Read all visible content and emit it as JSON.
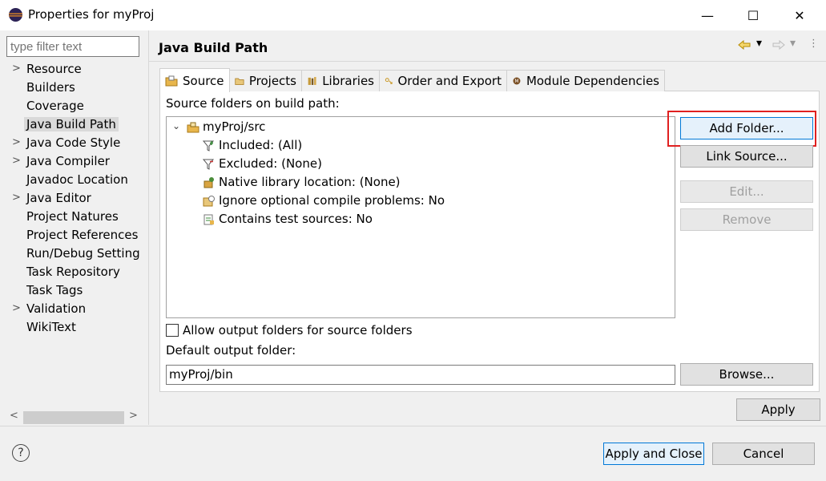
{
  "window": {
    "title": "Properties for myProj",
    "minimize_glyph": "—",
    "maximize_glyph": "☐",
    "close_glyph": "✕"
  },
  "filter": {
    "placeholder": "type filter text"
  },
  "left_tree": [
    {
      "label": "Resource",
      "expandable": true
    },
    {
      "label": "Builders",
      "expandable": false
    },
    {
      "label": "Coverage",
      "expandable": false
    },
    {
      "label": "Java Build Path",
      "expandable": false,
      "selected": true
    },
    {
      "label": "Java Code Style",
      "expandable": true
    },
    {
      "label": "Java Compiler",
      "expandable": true
    },
    {
      "label": "Javadoc Location",
      "expandable": false
    },
    {
      "label": "Java Editor",
      "expandable": true
    },
    {
      "label": "Project Natures",
      "expandable": false
    },
    {
      "label": "Project References",
      "expandable": false
    },
    {
      "label": "Run/Debug Setting",
      "expandable": false
    },
    {
      "label": "Task Repository",
      "expandable": false
    },
    {
      "label": "Task Tags",
      "expandable": false
    },
    {
      "label": "Validation",
      "expandable": true
    },
    {
      "label": "WikiText",
      "expandable": false
    }
  ],
  "page": {
    "title": "Java Build Path",
    "tabs": [
      {
        "label": "Source",
        "icon": "source-folder-icon"
      },
      {
        "label": "Projects",
        "icon": "projects-icon"
      },
      {
        "label": "Libraries",
        "icon": "libraries-icon"
      },
      {
        "label": "Order and Export",
        "icon": "order-export-icon"
      },
      {
        "label": "Module Dependencies",
        "icon": "module-icon"
      }
    ],
    "source_label": "Source folders on build path:",
    "source_root": "myProj/src",
    "source_children": [
      "Included: (All)",
      "Excluded: (None)",
      "Native library location: (None)",
      "Ignore optional compile problems: No",
      "Contains test sources: No"
    ],
    "buttons": {
      "add_folder": "Add Folder...",
      "link_source": "Link Source...",
      "edit": "Edit...",
      "remove": "Remove",
      "browse": "Browse..."
    },
    "allow_output_label": "Allow output folders for source folders",
    "default_output_label": "Default output folder:",
    "default_output_value": "myProj/bin"
  },
  "footer": {
    "apply": "Apply",
    "apply_close": "Apply and Close",
    "cancel": "Cancel",
    "help_glyph": "?"
  },
  "colors": {
    "highlight_box": "#e02020",
    "focus_border": "#0078d7"
  }
}
